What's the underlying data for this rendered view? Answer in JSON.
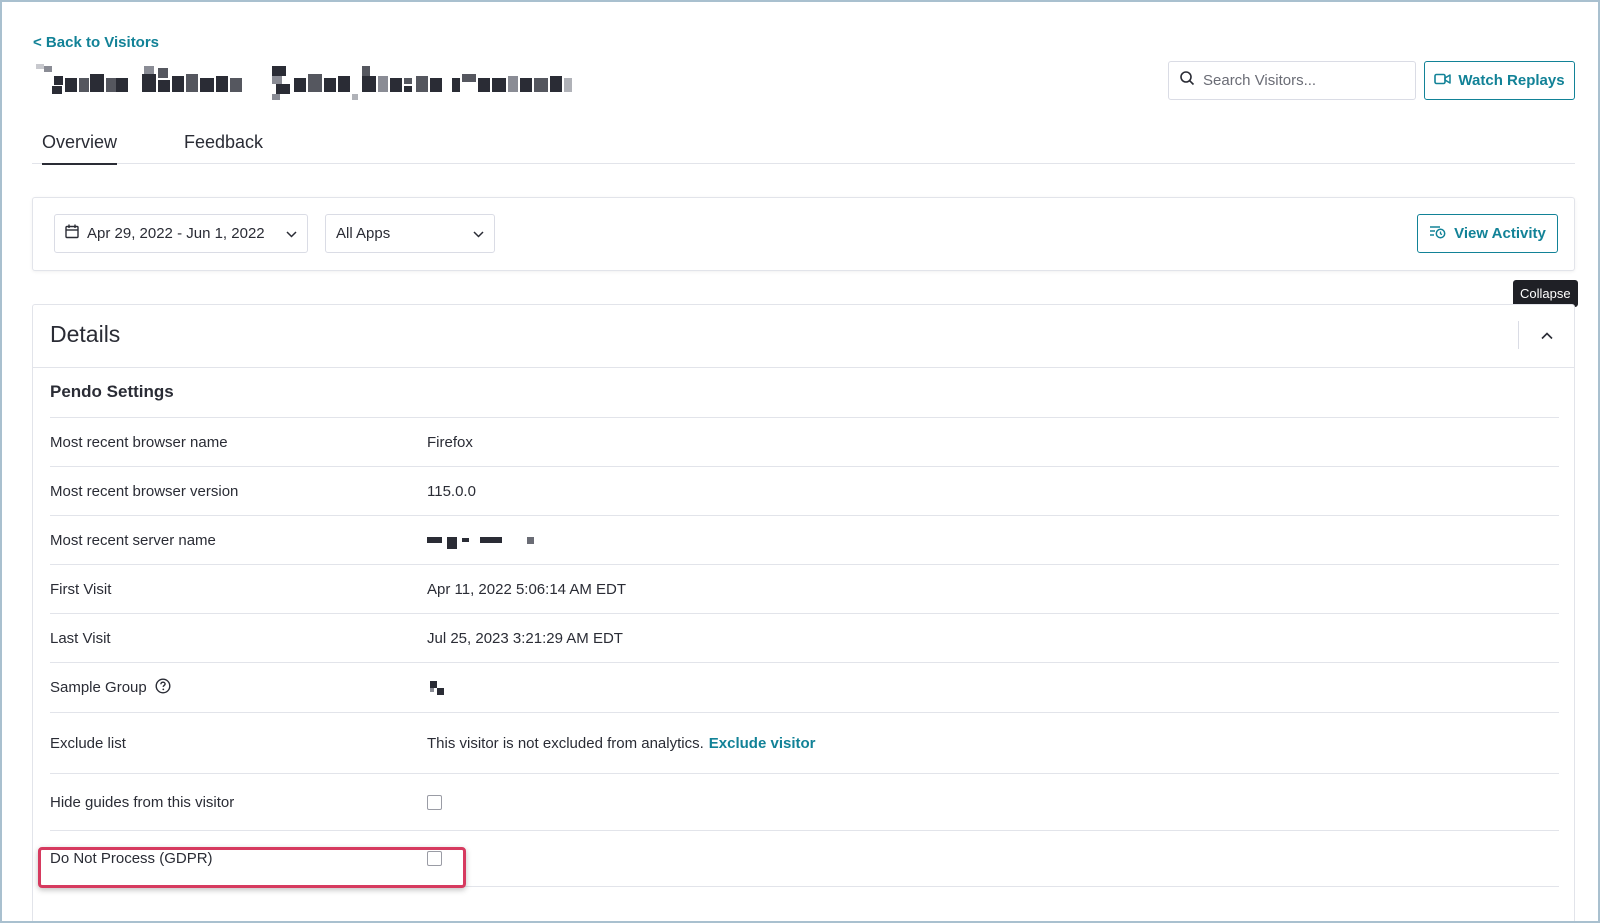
{
  "header": {
    "back_link": "< Back to Visitors",
    "visitor_name_redacted": "",
    "search_placeholder": "Search Visitors...",
    "watch_replays_label": "Watch Replays"
  },
  "tabs": [
    {
      "label": "Overview",
      "active": true
    },
    {
      "label": "Feedback",
      "active": false
    }
  ],
  "filters": {
    "date_range": "Apr 29, 2022 - Jun 1, 2022",
    "app": "All Apps",
    "view_activity_label": "View Activity"
  },
  "tooltip": "Collapse",
  "details": {
    "title": "Details",
    "section_title": "Pendo Settings",
    "rows": [
      {
        "label": "Most recent browser name",
        "value": "Firefox"
      },
      {
        "label": "Most recent browser version",
        "value": "115.0.0"
      },
      {
        "label": "Most recent server name",
        "value": ""
      },
      {
        "label": "First Visit",
        "value": "Apr 11, 2022 5:06:14 AM EDT"
      },
      {
        "label": "Last Visit",
        "value": "Jul 25, 2023 3:21:29 AM EDT"
      },
      {
        "label": "Sample Group",
        "value": ""
      },
      {
        "label": "Exclude list",
        "value": "This visitor is not excluded from analytics.",
        "link": "Exclude visitor"
      },
      {
        "label": "Hide guides from this visitor",
        "checked": false
      },
      {
        "label": "Do Not Process (GDPR)",
        "checked": false
      }
    ]
  },
  "colors": {
    "accent": "#128297",
    "highlight": "#d63a5f",
    "text": "#2a2c35",
    "tooltip_bg": "#1f2026"
  }
}
